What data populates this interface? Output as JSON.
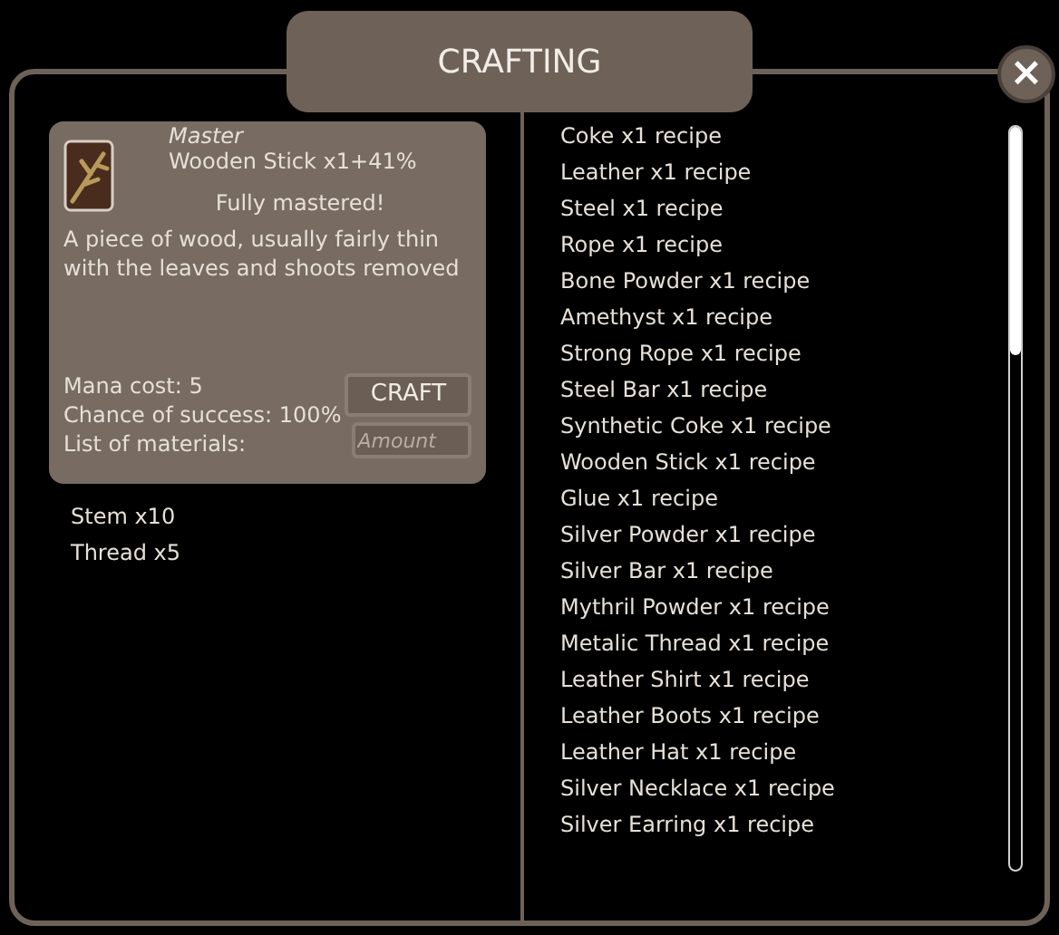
{
  "window": {
    "title": "CRAFTING",
    "close": "×"
  },
  "item": {
    "rank": "Master",
    "name": "Wooden Stick x1+41%",
    "status": "Fully mastered!",
    "description": "A piece of wood, usually fairly thin with the leaves and shoots removed",
    "mana_cost": "Mana cost: 5",
    "chance": "Chance of success: 100%",
    "materials_label": "List of materials:",
    "craft_button": "CRAFT",
    "amount_placeholder": "Amount"
  },
  "materials": [
    "Stem x10",
    "Thread x5"
  ],
  "recipes": [
    "Coke x1 recipe",
    "Leather x1 recipe",
    "Steel x1 recipe",
    "Rope x1 recipe",
    "Bone Powder x1 recipe",
    "Amethyst x1 recipe",
    "Strong Rope x1 recipe",
    "Steel Bar x1 recipe",
    "Synthetic Coke x1 recipe",
    "Wooden Stick x1 recipe",
    "Glue x1 recipe",
    "Silver Powder x1 recipe",
    "Silver Bar x1 recipe",
    "Mythril Powder x1 recipe",
    "Metalic Thread x1 recipe",
    "Leather Shirt x1 recipe",
    "Leather Boots x1 recipe",
    "Leather Hat x1 recipe",
    "Silver Necklace x1 recipe",
    "Silver Earring x1 recipe"
  ]
}
